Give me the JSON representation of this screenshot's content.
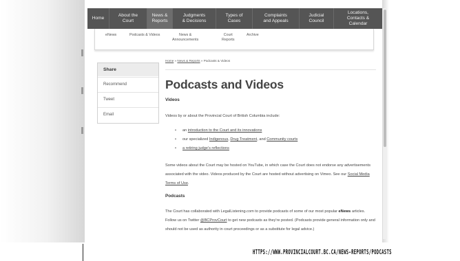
{
  "topnav": {
    "items": [
      {
        "label": "Home",
        "active": false
      },
      {
        "label": "About the\nCourt",
        "active": false
      },
      {
        "label": "News &\nReports",
        "active": true
      },
      {
        "label": "Judgments\n& Decisions",
        "active": false
      },
      {
        "label": "Types of\nCases",
        "active": false
      },
      {
        "label": "Complaints\nand Appeals",
        "active": false
      },
      {
        "label": "Judicial\nCouncil",
        "active": false
      },
      {
        "label": "Locations,\nContacts &\nCalendar",
        "active": false
      }
    ]
  },
  "subnav": {
    "items": [
      {
        "label": "eNews"
      },
      {
        "label": "Podcasts & Videos"
      },
      {
        "label": "News &\nAnnouncements"
      },
      {
        "label": "Court\nReports"
      },
      {
        "label": "Archive"
      }
    ]
  },
  "share": {
    "title": "Share",
    "items": [
      {
        "label": "Recommend"
      },
      {
        "label": "Tweet"
      },
      {
        "label": "Email"
      }
    ]
  },
  "breadcrumb": {
    "home": "Home",
    "sep1": " » ",
    "news": "News & Reports",
    "sep2": " » ",
    "current": "Podcasts & Videos"
  },
  "page": {
    "title": "Podcasts and Videos",
    "videos_heading": "Videos",
    "videos_intro": "Videos by or about the Provincial Court of British Columbia include:",
    "bullet1": {
      "prefix": "an ",
      "link": "introduction to the Court and its innovations"
    },
    "bullet2": {
      "prefix": "our specialized ",
      "link1": "Indigenous",
      "mid1": ", ",
      "link2": "Drug Treatment",
      "mid2": ", and ",
      "link3": "Community courts"
    },
    "bullet3": {
      "link": "a retiring judge's reflections"
    },
    "youtube_para": {
      "text": "Some videos about the Court may be hosted on YouTube, in which case the Court does not endorse any advertisements associated with the video. Videos produced by the Court are hosted without advertising on Vimeo. See our ",
      "link": "Social Media Terms of Use",
      "end": "."
    },
    "podcasts_heading": "Podcasts",
    "podcasts_para": {
      "part1": "The Court has collaborated with LegalListening.com to provide podcasts of some of our most popular ",
      "bold": "eNews",
      "part2": " articles. Follow us on Twitter ",
      "link": "@BCProvCourt",
      "part3": " to get new podcasts as they're posted. (Podcasts provide general information only and should not be used as authority in court proceedings or as a substitute for legal advice.)"
    }
  },
  "caption": {
    "url": "HTTPS://WWW.PROVINCIALCOURT.BC.CA/NEWS-REPORTS/PODCASTS"
  }
}
